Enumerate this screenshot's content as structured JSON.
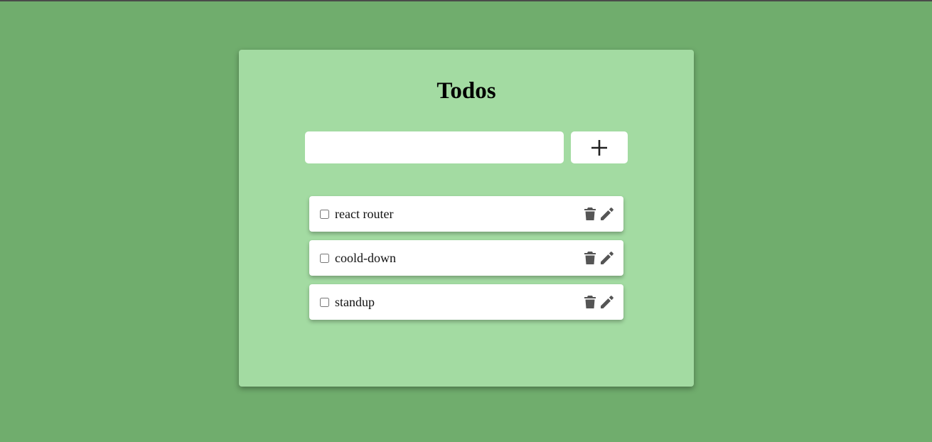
{
  "app": {
    "title": "Todos"
  },
  "new_todo": {
    "value": "",
    "placeholder": ""
  },
  "add_button": {
    "icon": "plus-icon"
  },
  "todos": [
    {
      "text": "react router",
      "checked": false
    },
    {
      "text": "coold-down",
      "checked": false
    },
    {
      "text": "standup",
      "checked": false
    }
  ],
  "icons": {
    "delete": "trash-icon",
    "edit": "pencil-icon"
  },
  "colors": {
    "background": "#70ad6d",
    "card": "#a3dba2",
    "icon": "#555555",
    "surface": "#ffffff"
  }
}
